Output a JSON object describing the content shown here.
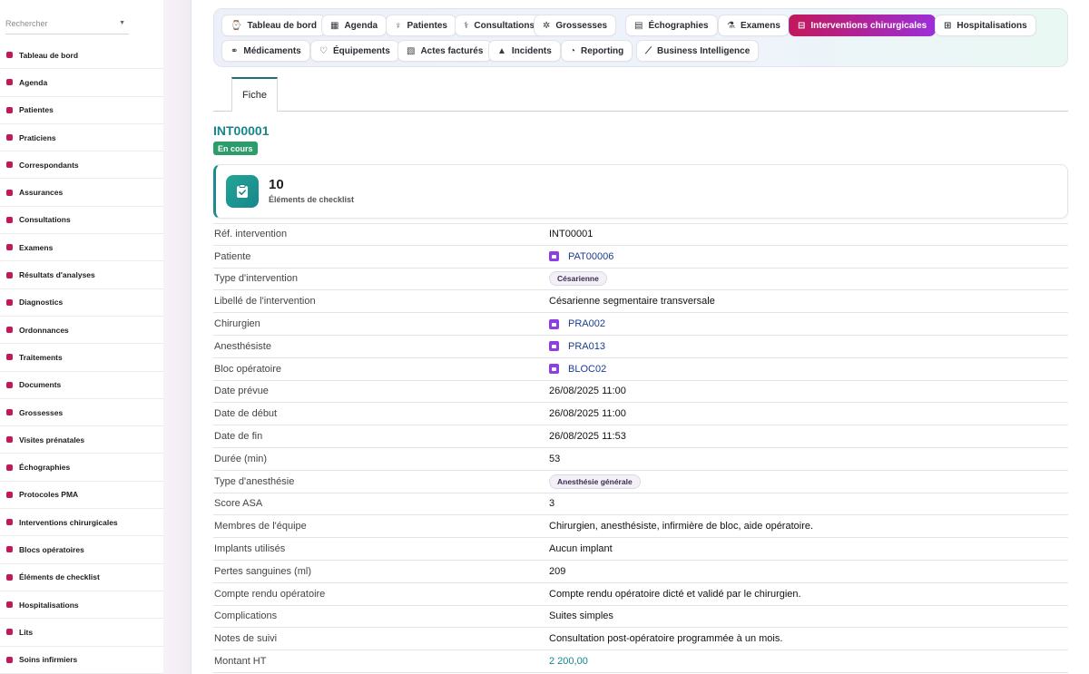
{
  "search": {
    "placeholder": "Rechercher"
  },
  "sidebar": {
    "items": [
      {
        "label": "Tableau de bord",
        "icon": "dashboard-icon"
      },
      {
        "label": "Agenda",
        "icon": "calendar-icon"
      },
      {
        "label": "Patientes",
        "icon": "female-icon"
      },
      {
        "label": "Praticiens",
        "icon": "doctor-icon"
      },
      {
        "label": "Correspondants",
        "icon": "user-icon"
      },
      {
        "label": "Assurances",
        "icon": "shield-icon"
      },
      {
        "label": "Consultations",
        "icon": "stethoscope-icon"
      },
      {
        "label": "Examens",
        "icon": "microscope-icon"
      },
      {
        "label": "Résultats d'analyses",
        "icon": "lab-results-icon"
      },
      {
        "label": "Diagnostics",
        "icon": "diagnostics-icon"
      },
      {
        "label": "Ordonnances",
        "icon": "prescription-icon"
      },
      {
        "label": "Traitements",
        "icon": "pills-icon"
      },
      {
        "label": "Documents",
        "icon": "document-icon"
      },
      {
        "label": "Grossesses",
        "icon": "baby-icon"
      },
      {
        "label": "Visites prénatales",
        "icon": "clipboard-icon"
      },
      {
        "label": "Échographies",
        "icon": "ultrasound-icon"
      },
      {
        "label": "Protocoles PMA",
        "icon": "hourglass-icon"
      },
      {
        "label": "Interventions chirurgicales",
        "icon": "bed-icon"
      },
      {
        "label": "Blocs opératoires",
        "icon": "operating-room-icon"
      },
      {
        "label": "Éléments de checklist",
        "icon": "checklist-icon"
      },
      {
        "label": "Hospitalisations",
        "icon": "hospital-icon"
      },
      {
        "label": "Lits",
        "icon": "bed-icon"
      },
      {
        "label": "Soins infirmiers",
        "icon": "nursing-icon"
      }
    ]
  },
  "tabs": [
    {
      "label": "Tableau de bord",
      "icon": "⌚"
    },
    {
      "label": "Agenda",
      "icon": "▦"
    },
    {
      "label": "Patientes",
      "icon": "♀"
    },
    {
      "label": "Consultations",
      "icon": "⚕"
    },
    {
      "label": "Grossesses",
      "icon": "✲"
    },
    {
      "label": "Échographies",
      "icon": "▤"
    },
    {
      "label": "Examens",
      "icon": "⚗"
    },
    {
      "label": "Interventions chirurgicales",
      "icon": "⊟"
    },
    {
      "label": "Hospitalisations",
      "icon": "⊞"
    },
    {
      "label": "Médicaments",
      "icon": "⚭"
    },
    {
      "label": "Équipements",
      "icon": "♡"
    },
    {
      "label": "Actes facturés",
      "icon": "▧"
    },
    {
      "label": "Incidents",
      "icon": "▲"
    },
    {
      "label": "Reporting",
      "icon": "◔"
    },
    {
      "label": "Business Intelligence",
      "icon": "⟋"
    }
  ],
  "active_tab": "Interventions chirurgicales",
  "subtab": {
    "label": "Fiche"
  },
  "record": {
    "reference": "INT00001",
    "status": "En cours",
    "status_color": "#2c9d6a"
  },
  "kpi": {
    "value": "10",
    "label": "Éléments de checklist",
    "icon": "clipboard-check-icon"
  },
  "details": [
    {
      "label": "Réf. intervention",
      "value": "INT00001",
      "kind": "text"
    },
    {
      "label": "Patiente",
      "value": "PAT00006",
      "kind": "link"
    },
    {
      "label": "Type d'intervention",
      "value": "Césarienne",
      "kind": "tag"
    },
    {
      "label": "Libellé de l'intervention",
      "value": "Césarienne segmentaire transversale",
      "kind": "text"
    },
    {
      "label": "Chirurgien",
      "value": "PRA002",
      "kind": "link"
    },
    {
      "label": "Anesthésiste",
      "value": "PRA013",
      "kind": "link"
    },
    {
      "label": "Bloc opératoire",
      "value": "BLOC02",
      "kind": "link"
    },
    {
      "label": "Date prévue",
      "value": "26/08/2025 11:00",
      "kind": "text"
    },
    {
      "label": "Date de début",
      "value": "26/08/2025 11:00",
      "kind": "text"
    },
    {
      "label": "Date de fin",
      "value": "26/08/2025 11:53",
      "kind": "text"
    },
    {
      "label": "Durée (min)",
      "value": "53",
      "kind": "text"
    },
    {
      "label": "Type d'anesthésie",
      "value": "Anesthésie générale",
      "kind": "tag"
    },
    {
      "label": "Score ASA",
      "value": "3",
      "kind": "text"
    },
    {
      "label": "Membres de l'équipe",
      "value": "Chirurgien, anesthésiste, infirmière de bloc, aide opératoire.",
      "kind": "text"
    },
    {
      "label": "Implants utilisés",
      "value": "Aucun implant",
      "kind": "text"
    },
    {
      "label": "Pertes sanguines (ml)",
      "value": "209",
      "kind": "text"
    },
    {
      "label": "Compte rendu opératoire",
      "value": "Compte rendu opératoire dicté et validé par le chirurgien.",
      "kind": "text"
    },
    {
      "label": "Complications",
      "value": "Suites simples",
      "kind": "text"
    },
    {
      "label": "Notes de suivi",
      "value": "Consultation post-opératoire programmée à un mois.",
      "kind": "text"
    },
    {
      "label": "Montant HT",
      "value": "2 200,00",
      "kind": "money"
    }
  ],
  "colors": {
    "accent_teal": "#17868c",
    "active_tab_gradient_start": "#c2185b",
    "active_tab_gradient_end": "#9c2fd8",
    "link_icon": "#8f3ee0",
    "sidebar_icon": "#c2185b"
  }
}
